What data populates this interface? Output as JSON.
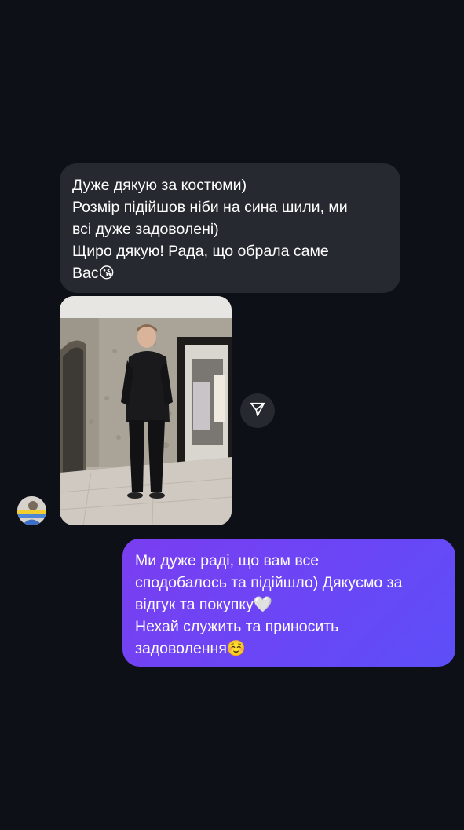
{
  "chat": {
    "incoming": {
      "lines": [
        "Дуже дякую за костюми)",
        "Розмір підійшов ніби на сина шили, ми",
        "всі дуже задоволені)",
        "Щиро дякую! Рада, що обрала саме",
        "Вас😘"
      ]
    },
    "outgoing": {
      "lines": [
        "Ми дуже раді, що вам все",
        "сподобалось та підійшло) Дякуємо за",
        "відгук та покупку🤍",
        "Нехай служить та приносить",
        "задоволення☺️"
      ]
    }
  },
  "icons": {
    "share": "paper-plane-icon"
  },
  "colors": {
    "background": "#0d1016",
    "incoming_bubble": "#262a30",
    "outgoing_gradient_start": "#7a3ef0",
    "outgoing_gradient_end": "#5d4ff8"
  }
}
